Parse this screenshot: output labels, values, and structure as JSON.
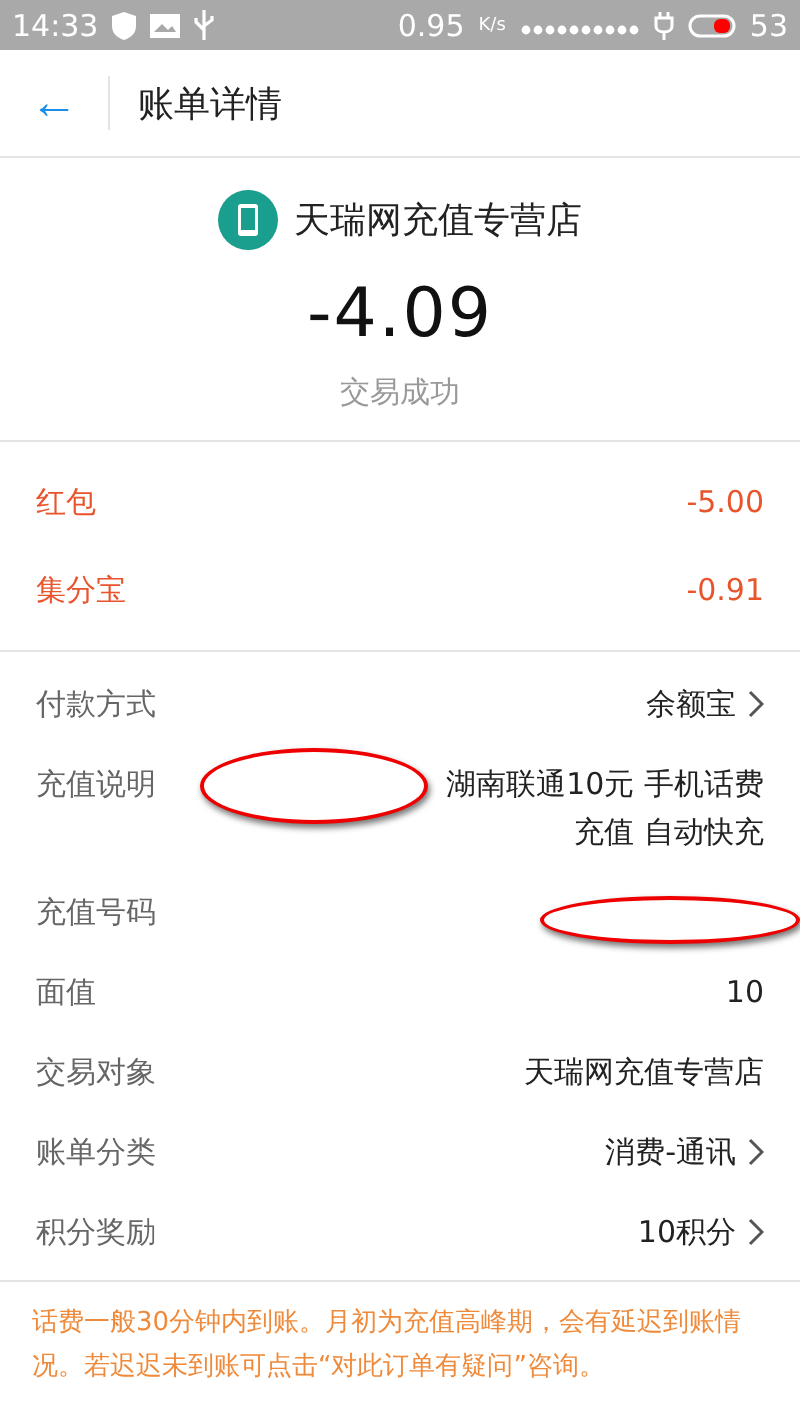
{
  "status_bar": {
    "time": "14:33",
    "speed": "0.95",
    "speed_unit": "K/s",
    "battery": "53"
  },
  "header": {
    "back_icon": "←",
    "title": "账单详情"
  },
  "merchant": {
    "name": "天瑞网充值专营店"
  },
  "amount": "-4.09",
  "result": "交易成功",
  "discounts": [
    {
      "label": "红包",
      "value": "-5.00"
    },
    {
      "label": "集分宝",
      "value": "-0.91"
    }
  ],
  "details": [
    {
      "label": "付款方式",
      "value": "余额宝",
      "chevron": true,
      "redacted": false
    },
    {
      "label": "充值说明",
      "value": "湖南联通10元 手机话费充值 自动快充",
      "chevron": false,
      "redacted": true
    },
    {
      "label": "充值号码",
      "chevron": false,
      "redacted": true
    },
    {
      "label": "面值",
      "value": "10",
      "chevron": false,
      "redacted": false
    },
    {
      "label": "交易对象",
      "value": "天瑞网充值专营店",
      "chevron": false,
      "redacted": false
    },
    {
      "label": "账单分类",
      "value": "消费-通讯",
      "chevron": true,
      "redacted": false
    },
    {
      "label": "积分奖励",
      "value": "10积分",
      "chevron": true,
      "redacted": false
    }
  ],
  "notice": "话费一般30分钟内到账。月初为充值高峰期，会有延迟到账情况。若迟迟未到账可点击“对此订单有疑问”咨询。"
}
